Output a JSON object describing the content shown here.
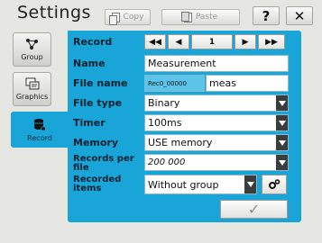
{
  "header": {
    "title": "Settings",
    "copy_label": "Copy",
    "paste_label": "Paste",
    "help_label": "?",
    "close_label": "✕"
  },
  "sidebar": {
    "items": [
      {
        "label": "Group",
        "icon": "network-icon"
      },
      {
        "label": "Graphics",
        "icon": "graphics-icon"
      },
      {
        "label": "Record",
        "icon": "database-icon",
        "active": true
      }
    ]
  },
  "form": {
    "record_label": "Record",
    "record_index": "1",
    "name_label": "Name",
    "name_value": "Measurement",
    "filename_label": "File name",
    "filename_prefix": "Rec0_00000",
    "filename_value": "meas",
    "filetype_label": "File type",
    "filetype_value": "Binary",
    "timer_label": "Timer",
    "timer_value": "100ms",
    "memory_label": "Memory",
    "memory_value": "USE memory",
    "records_per_file_label": "Records per file",
    "records_per_file_value": "200 000",
    "recorded_items_label": "Recorded items",
    "recorded_items_value": "Without group",
    "confirm_glyph": "✓"
  },
  "colors": {
    "accent": "#1aa5d8",
    "background": "#e6e7e2",
    "dropdown_arrow_bg": "#3c3c3c"
  }
}
